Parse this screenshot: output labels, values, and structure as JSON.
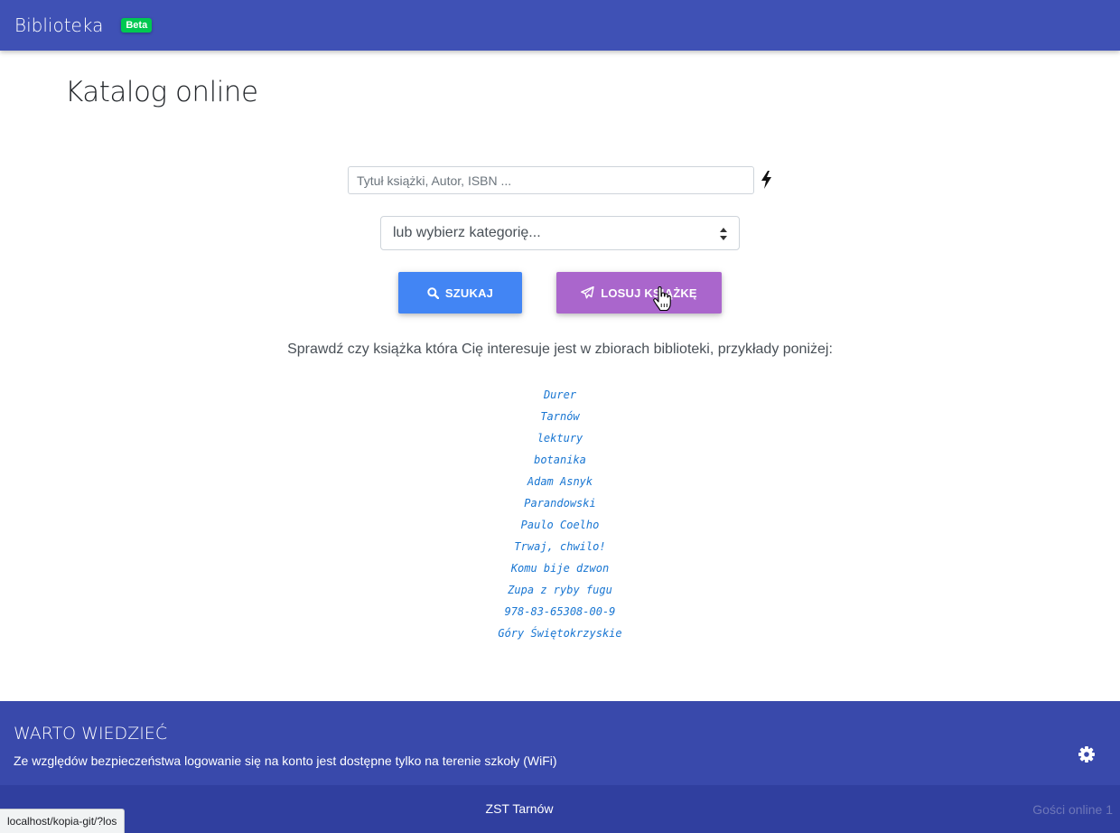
{
  "navbar": {
    "brand": "Biblioteka",
    "badge": "Beta"
  },
  "page_title": "Katalog online",
  "search": {
    "placeholder": "Tytuł książki, Autor, ISBN ...",
    "value": "",
    "icon": "bolt-icon"
  },
  "category_select": {
    "selected": "lub wybierz kategorię..."
  },
  "buttons": {
    "search_label": "SZUKAJ",
    "random_label": "LOSUJ KSIĄŻKĘ"
  },
  "intro": "Sprawdź czy książka która Cię interesuje jest w zbiorach biblioteki, przykłady poniżej:",
  "examples": [
    "Durer",
    "Tarnów",
    "lektury",
    "botanika",
    "Adam Asnyk",
    "Parandowski",
    "Paulo Coelho",
    "Trwaj, chwilo!",
    "Komu bije dzwon",
    "Zupa z ryby fugu",
    "978-83-65308-00-9",
    "Góry Świętokrzyskie"
  ],
  "info": {
    "title": "WARTO WIEDZIEĆ",
    "text": "Ze względów bezpieczeństwa logowanie się na konto jest dostępne tylko na terenie szkoły (WiFi)"
  },
  "footer": {
    "center": "ZST Tarnów",
    "online": "Gości online 1"
  },
  "status_bar": {
    "url": "localhost/kopia-git/?los"
  },
  "colors": {
    "navbar": "#3f51b5",
    "beta": "#00c851",
    "search_button": "#4285f4",
    "random_button": "#aa66cc",
    "link": "#1976d2",
    "info_bg": "#3949ab",
    "footer_bg": "#303f9f"
  }
}
